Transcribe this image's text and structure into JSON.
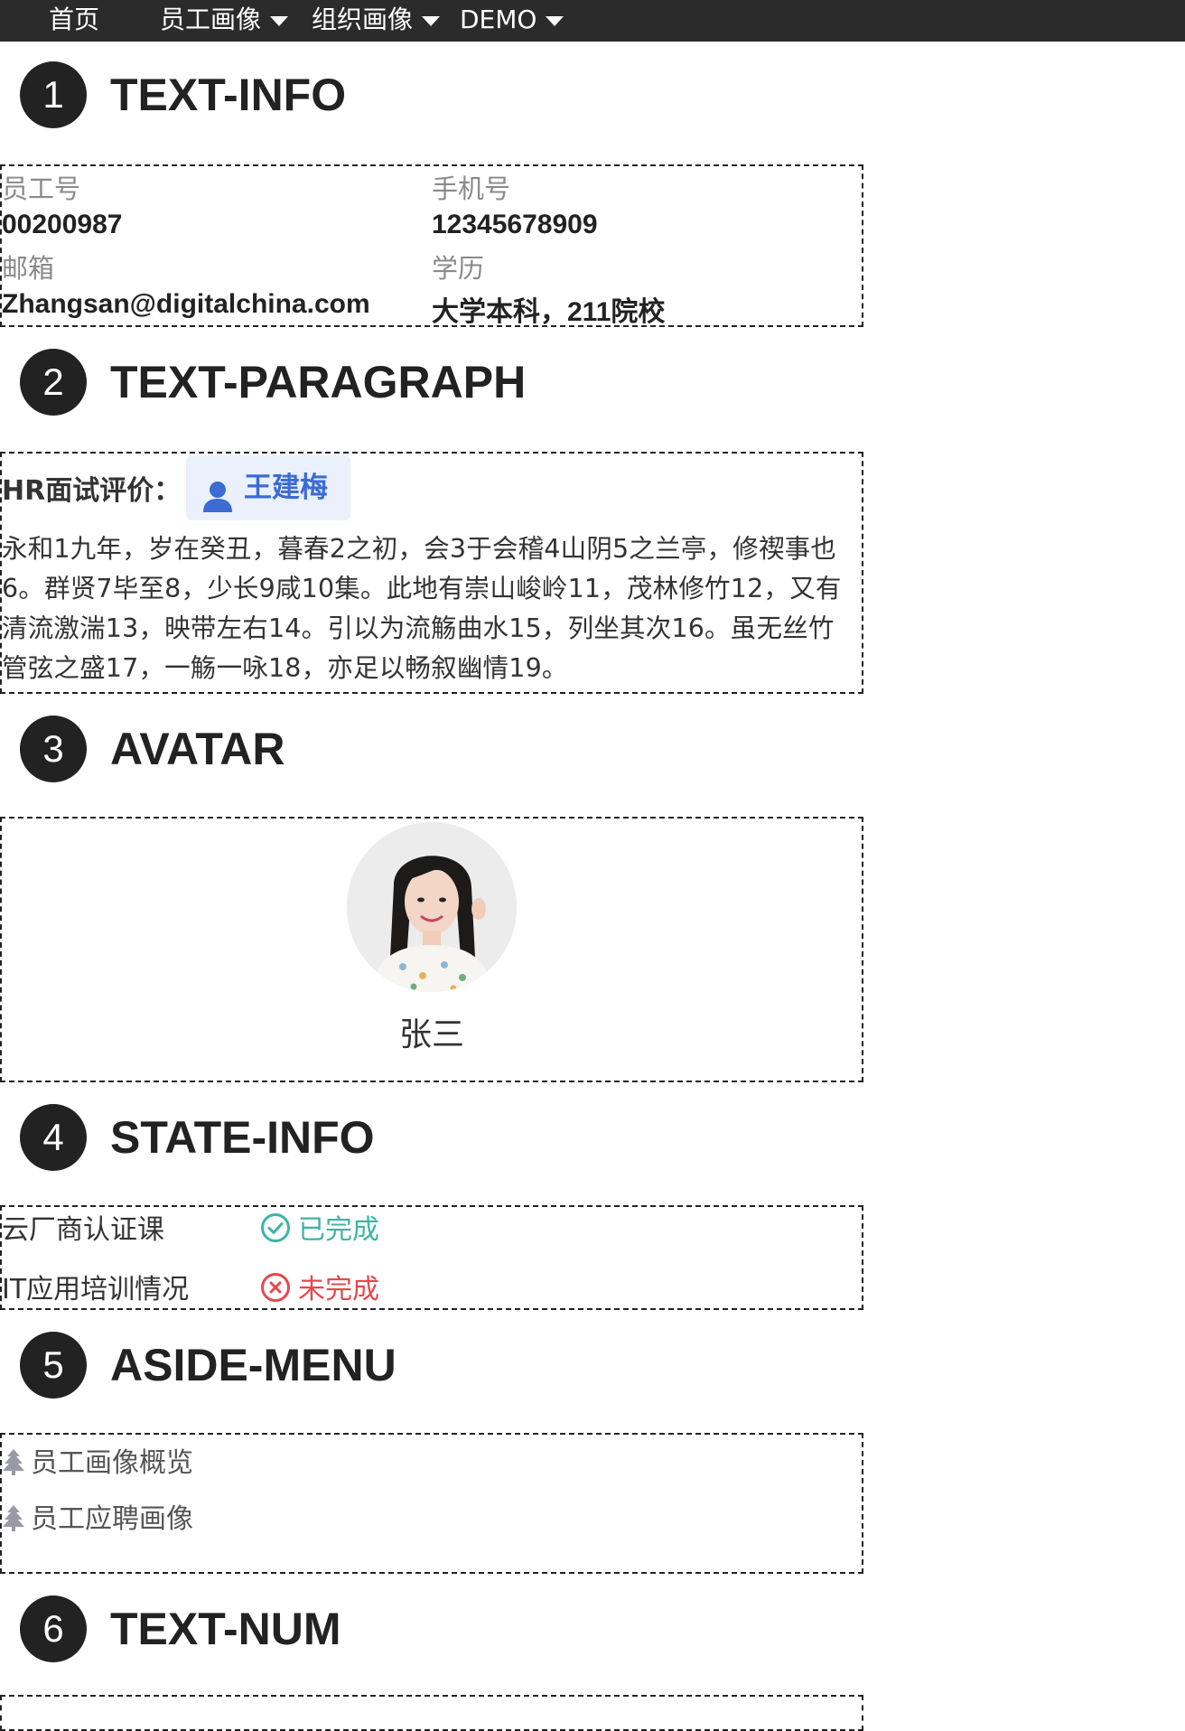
{
  "nav": {
    "home": "首页",
    "employee_portrait": "员工画像",
    "org_portrait": "组织画像",
    "demo": "DEMO"
  },
  "sections": [
    {
      "num": "1",
      "title": "TEXT-INFO"
    },
    {
      "num": "2",
      "title": "TEXT-PARAGRAPH"
    },
    {
      "num": "3",
      "title": "AVATAR"
    },
    {
      "num": "4",
      "title": "STATE-INFO"
    },
    {
      "num": "5",
      "title": "ASIDE-MENU"
    },
    {
      "num": "6",
      "title": "TEXT-NUM"
    }
  ],
  "text_info": {
    "employee_id_label": "员工号",
    "employee_id": "00200987",
    "phone_label": "手机号",
    "phone": "12345678909",
    "email_label": "邮箱",
    "email": "Zhangsan@digitalchina.com",
    "education_label": "学历",
    "education": "大学本科，211院校"
  },
  "paragraph": {
    "label": "HR面试评价：",
    "reviewer": "王建梅",
    "text": "永和1九年，岁在癸丑，暮春2之初，会3于会稽4山阴5之兰亭，修禊事也6。群贤7毕至8，少长9咸10集。此地有崇山峻岭11，茂林修竹12，又有清流激湍13，映带左右14。引以为流觞曲水15，列坐其次16。虽无丝竹管弦之盛17，一觞一咏18，亦足以畅叙幽情19。"
  },
  "avatar": {
    "name": "张三"
  },
  "state_info": [
    {
      "label": "云厂商认证课",
      "status": "已完成",
      "color": "#3cb4a6",
      "icon": "check-circle-icon"
    },
    {
      "label": "IT应用培训情况",
      "status": "未完成",
      "color": "#e5484d",
      "icon": "close-circle-icon"
    }
  ],
  "aside_menu": [
    {
      "label": "员工画像概览",
      "icon": "tree-icon"
    },
    {
      "label": "员工应聘画像",
      "icon": "tree-icon"
    }
  ],
  "colors": {
    "nav_bg": "#2b2b2b",
    "accent_blue": "#3b6bd3",
    "tag_bg": "#eaf0fc",
    "success": "#3cb4a6",
    "danger": "#e5484d"
  }
}
